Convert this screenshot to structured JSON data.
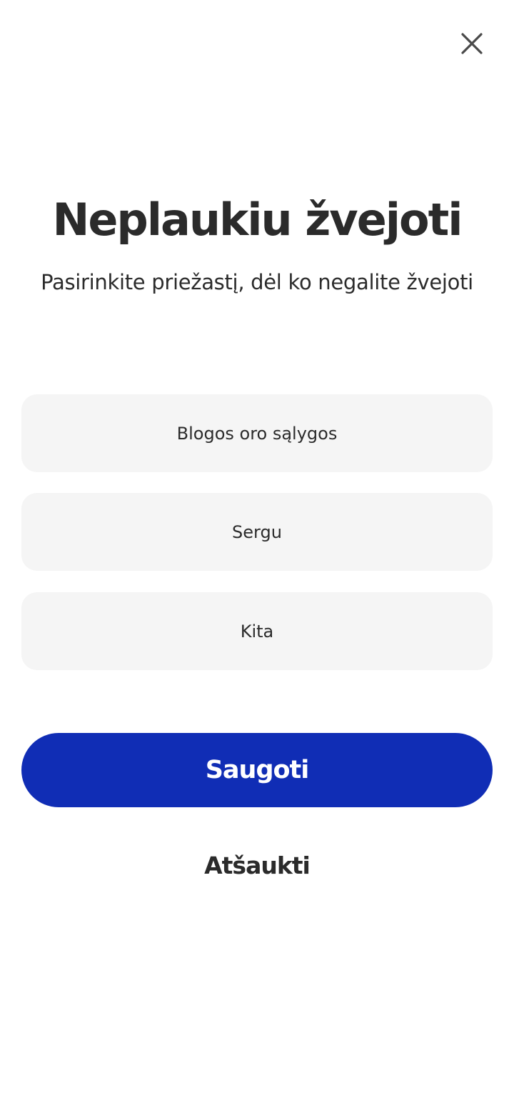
{
  "dialog": {
    "title": "Neplaukiu žvejoti",
    "subtitle": "Pasirinkite priežastį, dėl ko negalite žvejoti",
    "close_icon": "close-icon"
  },
  "options": [
    {
      "label": "Blogos oro sąlygos"
    },
    {
      "label": "Sergu"
    },
    {
      "label": "Kita"
    }
  ],
  "actions": {
    "save_label": "Saugoti",
    "cancel_label": "Atšaukti"
  },
  "colors": {
    "primary": "#102db5",
    "option_bg": "#f5f5f5",
    "text": "#2b2b2b"
  }
}
